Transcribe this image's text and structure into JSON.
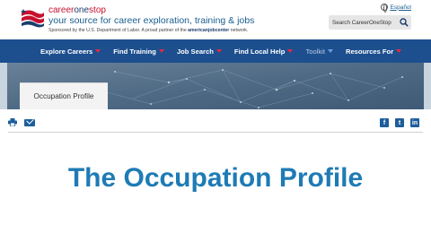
{
  "header": {
    "brand": {
      "part1": "career",
      "part2": "one",
      "part3": "stop"
    },
    "tagline": "your source for career exploration, training & jobs",
    "sponsor_before": "Sponsored by the U.S. Department of Labor. A proud partner of the ",
    "sponsor_partner": "americanjobcenter",
    "sponsor_after": " network.",
    "espanol": "Español",
    "search_placeholder": "Search CareerOneStop"
  },
  "nav": {
    "items": [
      {
        "label": "Explore Careers"
      },
      {
        "label": "Find Training"
      },
      {
        "label": "Job Search"
      },
      {
        "label": "Find Local Help"
      },
      {
        "label": "Toolkit"
      },
      {
        "label": "Resources For"
      }
    ]
  },
  "banner": {
    "tab_label": "Occupation Profile"
  },
  "social": {
    "facebook": "f",
    "twitter": "t",
    "linkedin": "in"
  },
  "main": {
    "title": "The Occupation Profile"
  },
  "colors": {
    "nav_bg": "#1d4f8f",
    "accent_red": "#c8102e",
    "title_blue": "#1e7bb5"
  }
}
